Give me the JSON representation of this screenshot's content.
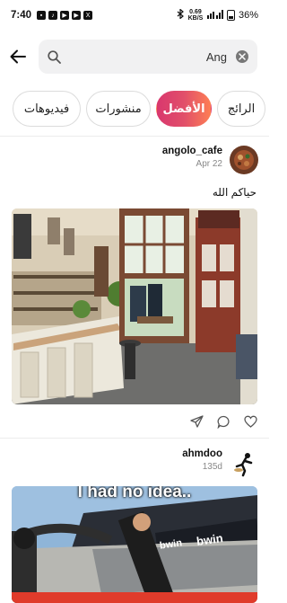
{
  "status_bar": {
    "time": "7:40",
    "network": "0.69 KB/S",
    "battery": "36%"
  },
  "search": {
    "value": "Ang",
    "placeholder": ""
  },
  "tabs": [
    {
      "label": "الرائج",
      "active": false
    },
    {
      "label": "الأفضل",
      "active": true
    },
    {
      "label": "منشورات",
      "active": false
    },
    {
      "label": "فيديوهات",
      "active": false
    }
  ],
  "posts": [
    {
      "username": "angolo_cafe",
      "date": "Apr 22",
      "caption": "حياكم الله"
    },
    {
      "username": "ahmdoo",
      "date": "135d",
      "image_text": "I had no idea..",
      "banner_text": "bwin"
    }
  ],
  "colors": {
    "accent_gradient_start": "#d9376e",
    "accent_gradient_end": "#fd7e54"
  }
}
